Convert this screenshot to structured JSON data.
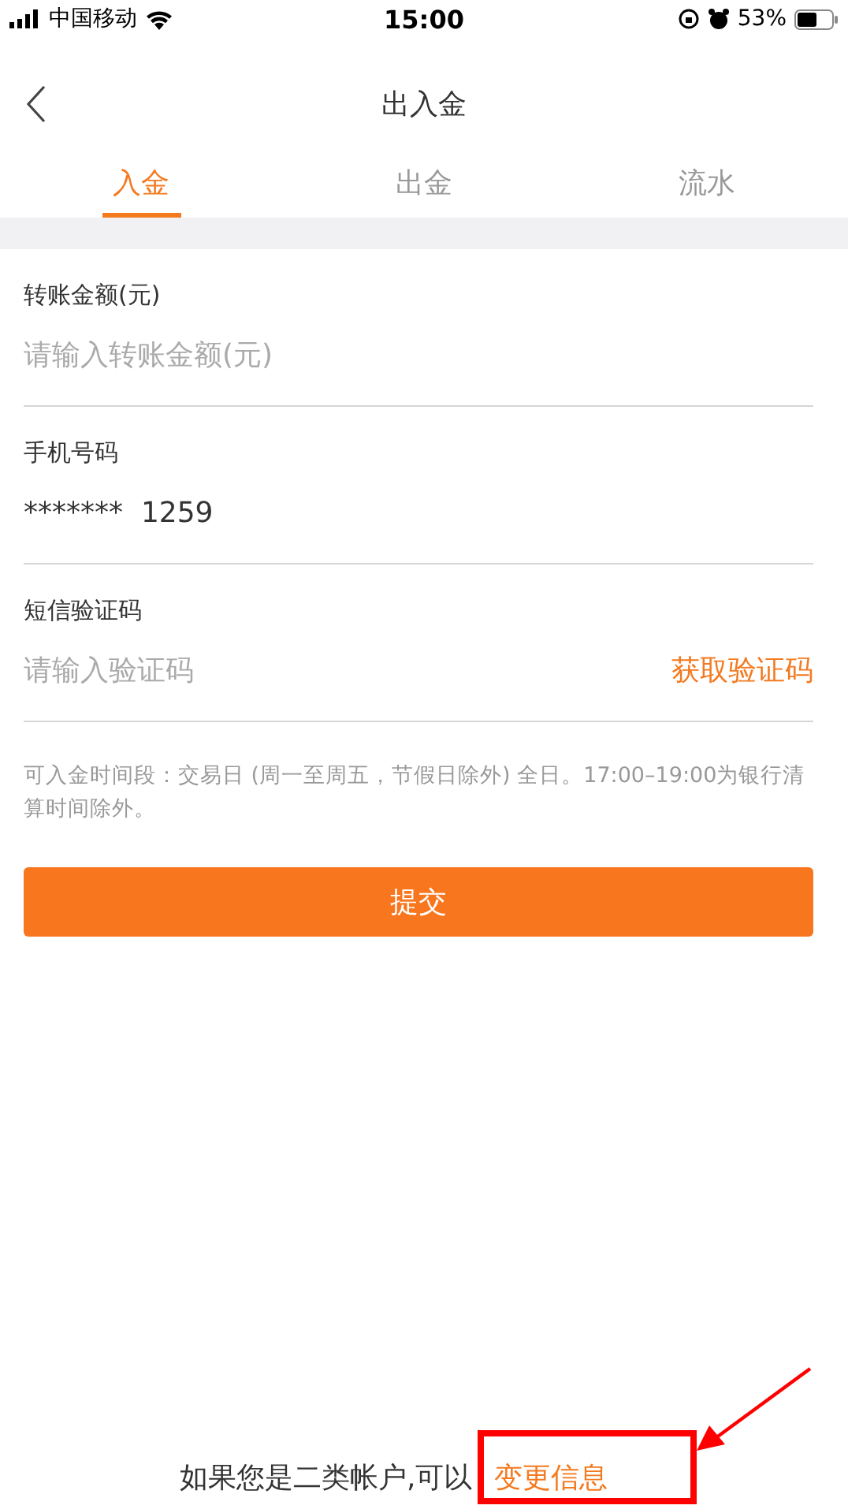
{
  "status_bar": {
    "carrier": "中国移动",
    "time": "15:00",
    "battery": "53%"
  },
  "nav": {
    "title": "出入金"
  },
  "tabs": [
    {
      "label": "入金",
      "selected": true
    },
    {
      "label": "出金",
      "selected": false
    },
    {
      "label": "流水",
      "selected": false
    }
  ],
  "fields": [
    {
      "label": "转账金额(元)",
      "placeholder": "请输入转账金额(元)"
    },
    {
      "label": "手机号码",
      "value": "*******  1259"
    },
    {
      "label": "短信验证码",
      "placeholder": "请输入验证码",
      "action": "获取验证码"
    }
  ],
  "note": "可入金时间段：交易日 (周一至周五，节假日除外) 全日。17:00–19:00为银行清算时间除外。",
  "submit": "提交",
  "footer": {
    "text": "如果您是二类帐户,可以",
    "link": "变更信息"
  }
}
